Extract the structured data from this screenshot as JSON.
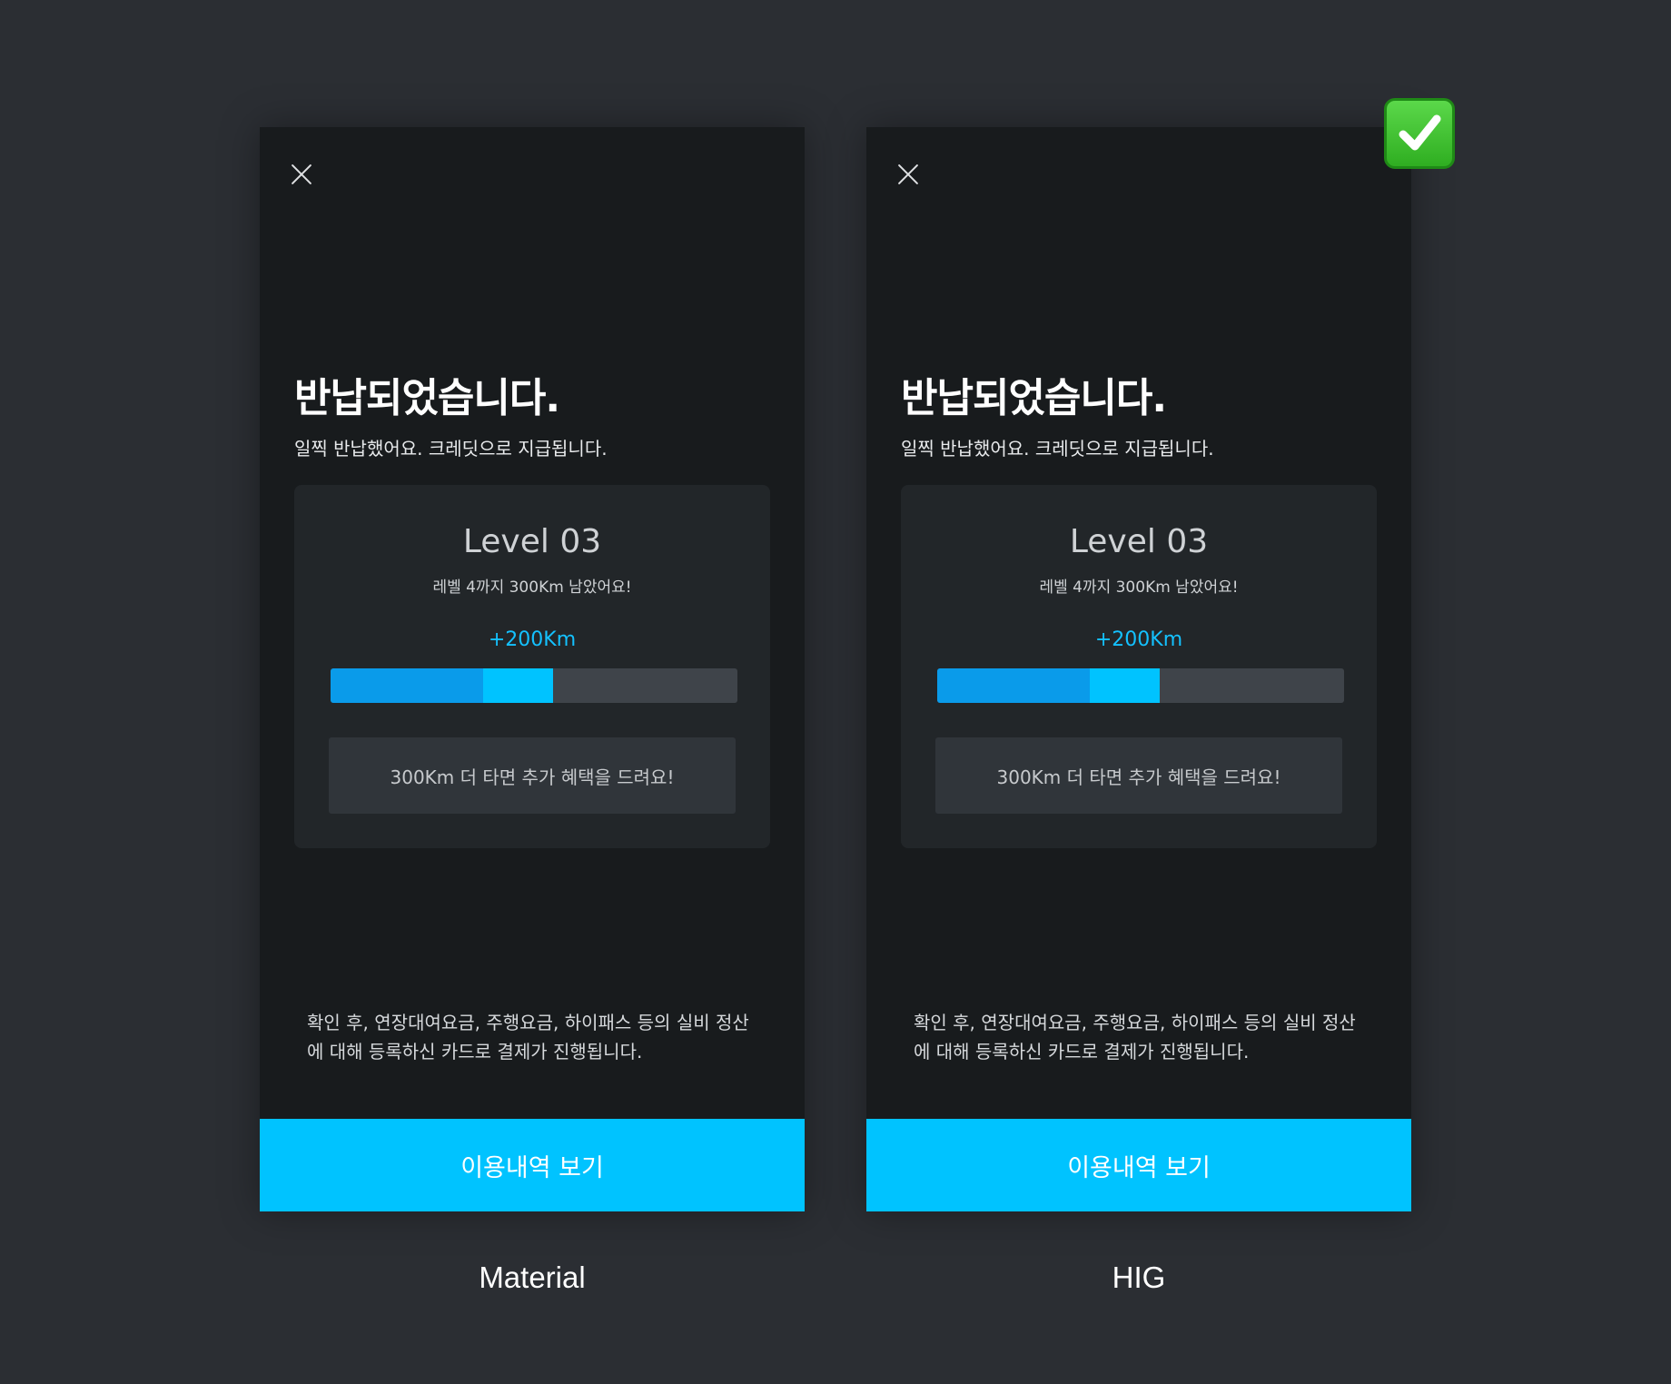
{
  "variants": [
    {
      "name": "Material",
      "title": "반납되었습니다.",
      "subtitle": "일찍 반납했어요. 크레딧으로 지급됩니다.",
      "card": {
        "level": "Level 03",
        "level_sub": "레벨 4까지 300Km 남았어요!",
        "gain": "+200Km",
        "progress": {
          "base": 0.375,
          "gain": 0.172
        },
        "benefit": "300Km 더 타면 추가 혜택을 드려요!"
      },
      "notice": "확인 후, 연장대여요금, 주행요금, 하이패스 등의 실비 정산에 대해 등록하신 카드로 결제가 진행됩니다.",
      "cta": "이용내역 보기"
    },
    {
      "name": "HIG",
      "title": "반납되었습니다.",
      "subtitle": "일찍 반납했어요. 크레딧으로 지급됩니다.",
      "card": {
        "level": "Level 03",
        "level_sub": "레벨 4까지 300Km 남았어요!",
        "gain": "+200Km",
        "progress": {
          "base": 0.375,
          "gain": 0.172
        },
        "benefit": "300Km 더 타면 추가 혜택을 드려요!"
      },
      "notice": "확인 후, 연장대여요금, 주행요금, 하이패스 등의 실비 정산에 대해 등록하신 카드로 결제가 진행됩니다.",
      "cta": "이용내역 보기"
    }
  ],
  "badge": {
    "icon": "check-mark-icon",
    "color": "#2fae21"
  },
  "colors": {
    "accent": "#00c3ff",
    "progress_base": "#0a9bea",
    "background": "#2b2e33",
    "screen": "#181b1d"
  }
}
